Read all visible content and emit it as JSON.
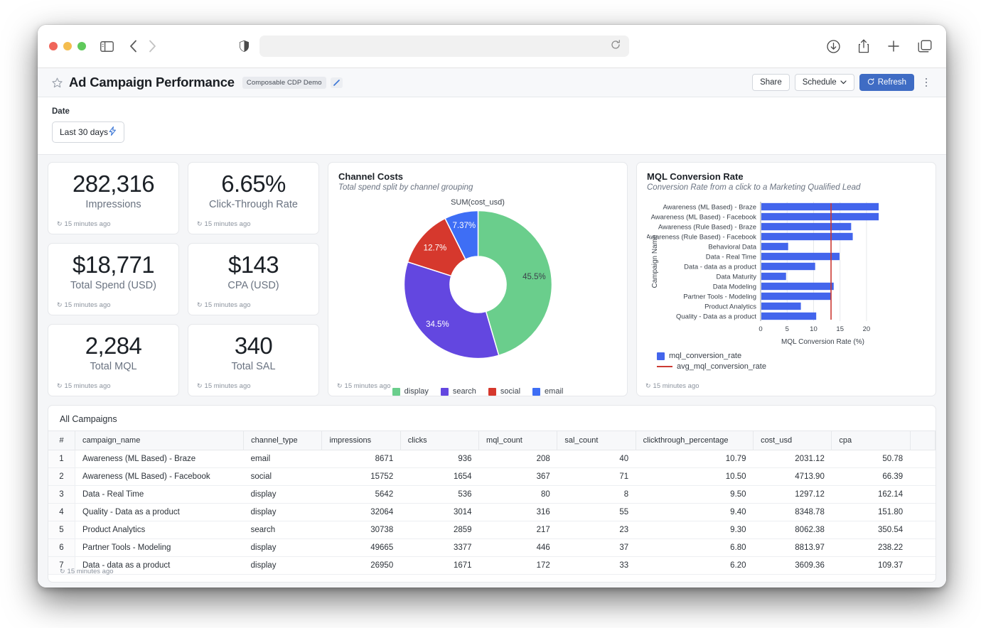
{
  "browser": {
    "url_value": "",
    "url_placeholder": "",
    "icons": {
      "sidebar": "sidebar-icon",
      "back": "back-arrow-icon",
      "forward": "forward-arrow-icon",
      "shield": "shield-icon",
      "reload": "reload-icon",
      "download": "download-icon",
      "share": "share-icon",
      "new_tab": "plus-icon",
      "tabs": "tab-overview-icon"
    }
  },
  "header": {
    "title": "Ad Campaign Performance",
    "space_chip": "Composable CDP Demo",
    "edit_icon": "pencil-icon",
    "star_icon": "star-icon",
    "share_label": "Share",
    "schedule_label": "Schedule",
    "refresh_label": "Refresh",
    "more_icon": "kebab-menu-icon"
  },
  "filters": {
    "label": "Date",
    "date_value": "Last 30 days",
    "bolt_icon": "lightning-bolt-icon"
  },
  "stamp": "15 minutes ago",
  "kpis": [
    {
      "value": "282,316",
      "label": "Impressions",
      "stamp": "15 minutes ago"
    },
    {
      "value": "6.65%",
      "label": "Click-Through Rate",
      "stamp": "15 minutes ago"
    },
    {
      "value": "$18,771",
      "label": "Total Spend (USD)",
      "stamp": "15 minutes ago"
    },
    {
      "value": "$143",
      "label": "CPA (USD)",
      "stamp": "15 minutes ago"
    },
    {
      "value": "2,284",
      "label": "Total MQL",
      "stamp": "15 minutes ago"
    },
    {
      "value": "340",
      "label": "Total SAL",
      "stamp": "15 minutes ago"
    }
  ],
  "donut_card": {
    "title": "Channel Costs",
    "subtitle": "Total spend split by channel grouping",
    "stamp": "15 minutes ago"
  },
  "bar_card": {
    "title": "MQL Conversion Rate",
    "subtitle": "Conversion Rate from a click to a Marketing Qualified Lead",
    "stamp": "15 minutes ago"
  },
  "table": {
    "title": "All Campaigns",
    "stamp": "15 minutes ago",
    "columns": [
      "#",
      "campaign_name",
      "channel_type",
      "impressions",
      "clicks",
      "mql_count",
      "sal_count",
      "clickthrough_percentage",
      "cost_usd",
      "cpa",
      ""
    ],
    "rows": [
      [
        "1",
        "Awareness (ML Based) - Braze",
        "email",
        "8671",
        "936",
        "208",
        "40",
        "10.79",
        "2031.12",
        "50.78",
        ""
      ],
      [
        "2",
        "Awareness (ML Based) - Facebook",
        "social",
        "15752",
        "1654",
        "367",
        "71",
        "10.50",
        "4713.90",
        "66.39",
        ""
      ],
      [
        "3",
        "Data - Real Time",
        "display",
        "5642",
        "536",
        "80",
        "8",
        "9.50",
        "1297.12",
        "162.14",
        ""
      ],
      [
        "4",
        "Quality - Data as a product",
        "display",
        "32064",
        "3014",
        "316",
        "55",
        "9.40",
        "8348.78",
        "151.80",
        ""
      ],
      [
        "5",
        "Product Analytics",
        "search",
        "30738",
        "2859",
        "217",
        "23",
        "9.30",
        "8062.38",
        "350.54",
        ""
      ],
      [
        "6",
        "Partner Tools - Modeling",
        "display",
        "49665",
        "3377",
        "446",
        "37",
        "6.80",
        "8813.97",
        "238.22",
        ""
      ],
      [
        "7",
        "Data - data as a product",
        "display",
        "26950",
        "1671",
        "172",
        "33",
        "6.20",
        "3609.36",
        "109.37",
        ""
      ]
    ]
  },
  "chart_data": [
    {
      "type": "pie",
      "title": "Channel Costs",
      "subtitle": "Total spend split by channel grouping",
      "value_label": "SUM(cost_usd)",
      "donut": true,
      "inner_radius_ratio": 0.38,
      "legend_position": "bottom",
      "categories": [
        "display",
        "search",
        "social",
        "email"
      ],
      "values": [
        45.5,
        34.5,
        12.7,
        7.37
      ],
      "data_labels": [
        "45.5%",
        "34.5%",
        "12.7%",
        "7.37%"
      ],
      "colors": [
        "#6ace8c",
        "#6347e0",
        "#d6382d",
        "#3e6ef5"
      ]
    },
    {
      "type": "bar",
      "orientation": "horizontal",
      "title": "MQL Conversion Rate",
      "subtitle": "Conversion Rate from a click to a Marketing Qualified Lead",
      "ylabel": "Campaign Name",
      "xlabel": "MQL Conversion Rate (%)",
      "xlim": [
        0,
        23.5
      ],
      "xticks": [
        0,
        5,
        10,
        15,
        20
      ],
      "grid": true,
      "legend_position": "bottom-left",
      "categories": [
        "Awareness (ML Based) - Braze",
        "Awareness (ML Based) - Facebook",
        "Awareness (Rule Based) - Braze",
        "Awareness (Rule Based) - Facebook",
        "Behavioral Data",
        "Data - Real Time",
        "Data - data as a product",
        "Data Maturity",
        "Data Modeling",
        "Partner Tools - Modeling",
        "Product Analytics",
        "Quality - Data as a product"
      ],
      "series": [
        {
          "name": "mql_conversion_rate",
          "color": "#4365ec",
          "values": [
            22.3,
            22.3,
            17.1,
            17.4,
            5.2,
            14.9,
            10.3,
            4.8,
            13.8,
            13.3,
            7.6,
            10.5
          ]
        }
      ],
      "reference_line": {
        "name": "avg_mql_conversion_rate",
        "color": "#cc3a33",
        "value": 13.3
      }
    }
  ]
}
